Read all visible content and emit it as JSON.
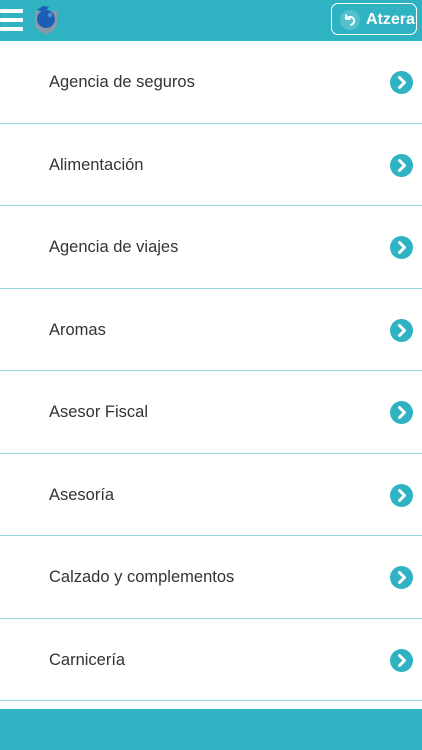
{
  "header": {
    "back_label": "Atzera"
  },
  "categories": [
    {
      "label": "Agencia de seguros"
    },
    {
      "label": "Alimentación"
    },
    {
      "label": "Agencia de viajes"
    },
    {
      "label": "Aromas"
    },
    {
      "label": "Asesor Fiscal"
    },
    {
      "label": "Asesoría"
    },
    {
      "label": "Calzado y complementos"
    },
    {
      "label": "Carnicería"
    }
  ],
  "icons": {
    "menu": "hamburger-menu-icon",
    "logo": "app-logo",
    "back": "undo-arrow-icon",
    "item": "chevron-right-icon"
  },
  "colors": {
    "accent": "#2fb2c2",
    "divider": "#9bd7df",
    "text": "#333333",
    "logo_blue": "#1a5fb4",
    "logo_gray": "#8a9aa6"
  }
}
